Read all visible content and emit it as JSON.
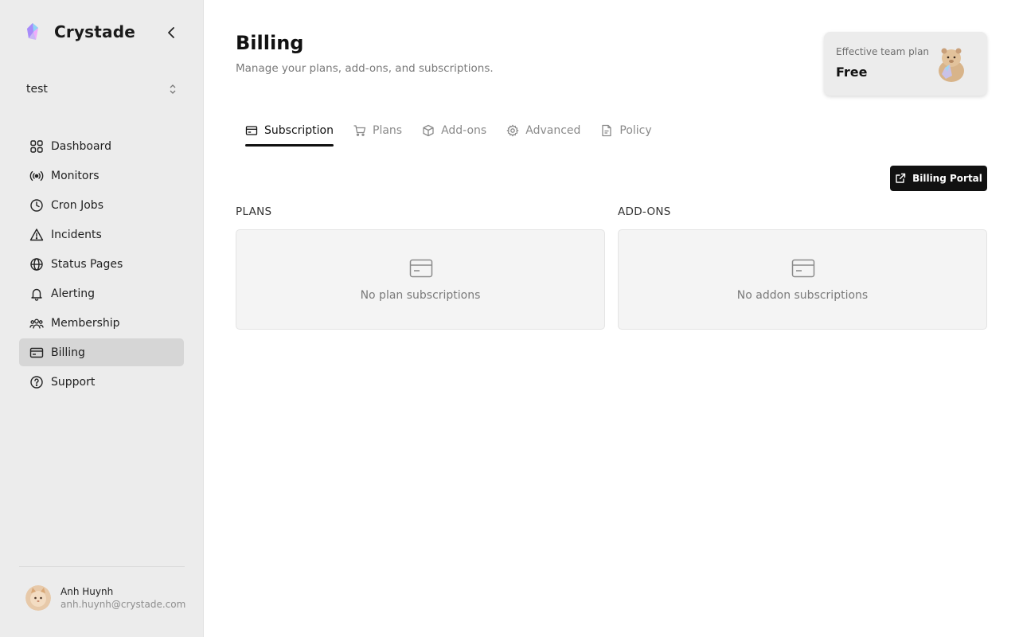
{
  "brand": {
    "name": "Crystade"
  },
  "team": {
    "name": "test"
  },
  "nav": {
    "items": [
      {
        "label": "Dashboard",
        "icon": "dashboard-icon"
      },
      {
        "label": "Monitors",
        "icon": "broadcast-icon"
      },
      {
        "label": "Cron Jobs",
        "icon": "clock-icon"
      },
      {
        "label": "Incidents",
        "icon": "warning-icon"
      },
      {
        "label": "Status Pages",
        "icon": "globe-icon"
      },
      {
        "label": "Alerting",
        "icon": "bell-icon"
      },
      {
        "label": "Membership",
        "icon": "users-icon"
      },
      {
        "label": "Billing",
        "icon": "credit-card-icon",
        "active": true
      },
      {
        "label": "Support",
        "icon": "help-circle-icon"
      }
    ]
  },
  "user": {
    "name": "Anh Huynh",
    "email": "anh.huynh@crystade.com"
  },
  "page": {
    "title": "Billing",
    "subtitle": "Manage your plans, add-ons, and subscriptions."
  },
  "plan_card": {
    "label": "Effective team plan",
    "value": "Free"
  },
  "tabs": [
    {
      "label": "Subscription",
      "icon": "credit-card-icon",
      "active": true
    },
    {
      "label": "Plans",
      "icon": "cart-icon"
    },
    {
      "label": "Add-ons",
      "icon": "box-icon"
    },
    {
      "label": "Advanced",
      "icon": "gear-icon"
    },
    {
      "label": "Policy",
      "icon": "document-icon"
    }
  ],
  "actions": {
    "billing_portal_label": "Billing Portal"
  },
  "sections": {
    "plans": {
      "heading": "PLANS",
      "empty_text": "No plan subscriptions"
    },
    "addons": {
      "heading": "ADD-ONS",
      "empty_text": "No addon subscriptions"
    }
  },
  "colors": {
    "sidebar_bg": "#ececec",
    "active_nav_bg": "#d6d6d6",
    "primary_button": "#111111"
  }
}
